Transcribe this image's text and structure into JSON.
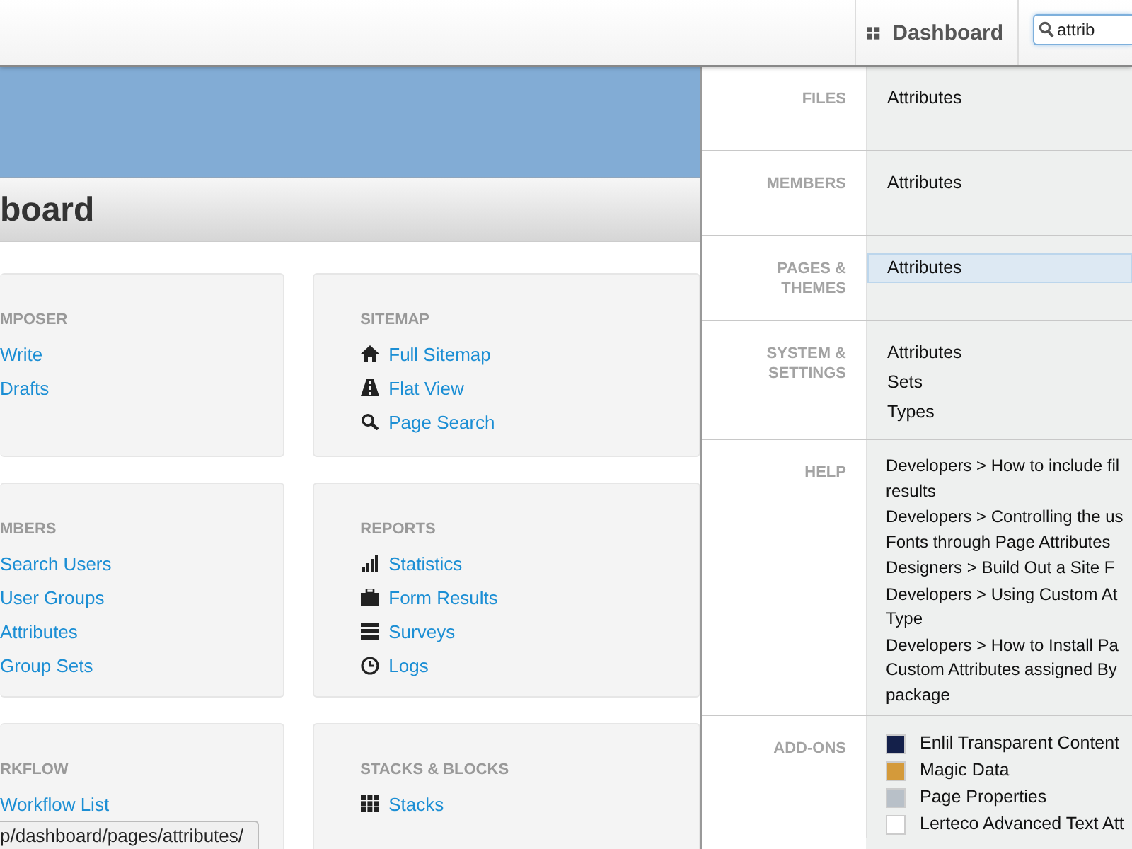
{
  "top_bar": {
    "dashboard_button": "Dashboard",
    "search": {
      "value": "attrib"
    }
  },
  "header": {
    "title": "board"
  },
  "card_rows": [
    [
      {
        "heading": "MPOSER",
        "links": [
          "Write",
          "Drafts"
        ]
      },
      {
        "heading": "SITEMAP",
        "links": [
          "Full Sitemap",
          "Flat View",
          "Page Search"
        ]
      }
    ],
    [
      {
        "heading": "MBERS",
        "links": [
          "Search Users",
          "User Groups",
          "Attributes",
          "Group Sets"
        ]
      },
      {
        "heading": "REPORTS",
        "links": [
          "Statistics",
          "Form Results",
          "Surveys",
          "Logs"
        ]
      }
    ],
    [
      {
        "heading": "RKFLOW",
        "links": [
          "Workflow List"
        ]
      },
      {
        "heading": "STACKS & BLOCKS",
        "links": [
          "Stacks"
        ]
      }
    ]
  ],
  "search_results": [
    {
      "kind": "plain",
      "label": "FILES",
      "items": [
        {
          "text": "Attributes",
          "selected": false
        }
      ]
    },
    {
      "kind": "plain",
      "label": "MEMBERS",
      "items": [
        {
          "text": "Attributes",
          "selected": false
        }
      ]
    },
    {
      "kind": "plain",
      "label": "PAGES & THEMES",
      "items": [
        {
          "text": "Attributes",
          "selected": true
        }
      ]
    },
    {
      "kind": "plain",
      "label": "SYSTEM & SETTINGS",
      "items": [
        {
          "text": "Attributes",
          "selected": false
        },
        {
          "text": "Sets",
          "selected": false
        },
        {
          "text": "Types",
          "selected": false
        }
      ]
    },
    {
      "kind": "help",
      "label": "HELP",
      "items": [
        {
          "lines": [
            "Developers > How to include fil",
            "results"
          ],
          "selected": false
        },
        {
          "lines": [
            "Developers > Controlling the us",
            "Fonts through Page Attributes"
          ],
          "selected": false
        },
        {
          "lines": [
            "Designers > Build Out a Site F"
          ],
          "selected": false
        },
        {
          "lines": [
            "Developers > Using Custom At",
            "Type"
          ],
          "selected": false
        },
        {
          "lines": [
            "Developers > How to Install Pa",
            "Custom Attributes assigned By",
            "package"
          ],
          "selected": false
        }
      ]
    },
    {
      "kind": "addon",
      "label": "ADD-ONS",
      "items": [
        {
          "text": "Enlil Transparent Content",
          "selected": false
        },
        {
          "text": "Magic Data",
          "selected": false
        },
        {
          "text": "Page Properties",
          "selected": false
        },
        {
          "text": "Lerteco Advanced Text Att",
          "selected": false
        }
      ]
    }
  ],
  "status_url": "p/dashboard/pages/attributes/"
}
